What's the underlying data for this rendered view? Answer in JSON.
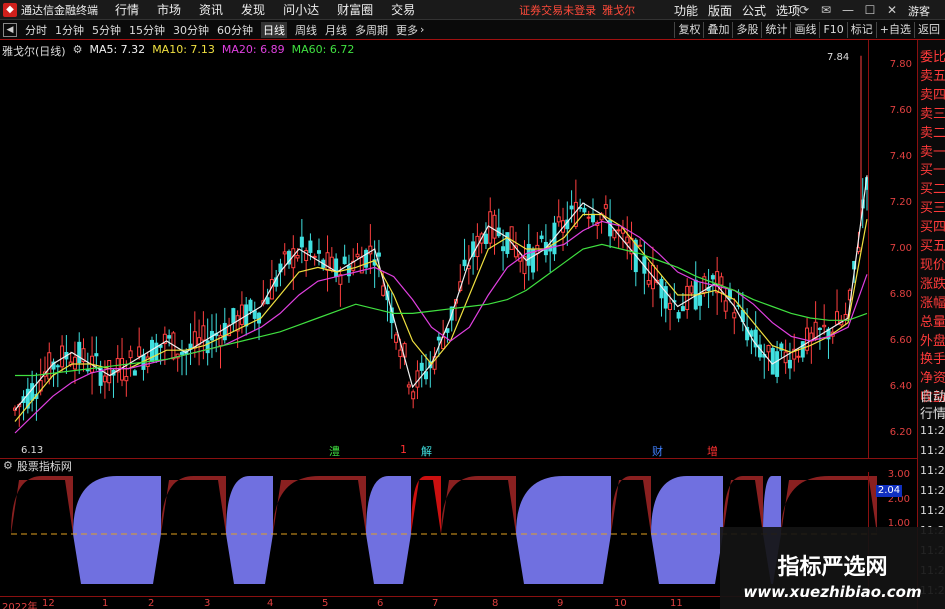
{
  "titlebar": {
    "app_title": "通达信金融终端",
    "menus": [
      "行情",
      "市场",
      "资讯",
      "发现",
      "问小达",
      "财富圈",
      "交易"
    ],
    "login_status": "证券交易未登录",
    "login_name": "雅戈尔",
    "right_menus": [
      "功能",
      "版面",
      "公式",
      "选项"
    ],
    "guest": "游客"
  },
  "toolbar": {
    "periods": [
      "分时",
      "1分钟",
      "5分钟",
      "15分钟",
      "30分钟",
      "60分钟",
      "日线",
      "周线",
      "月线",
      "多周期",
      "更多"
    ],
    "active_period": "日线",
    "right_tools": [
      "复权",
      "叠加",
      "多股",
      "统计",
      "画线",
      "F10",
      "标记",
      "+自选",
      "返回"
    ]
  },
  "chart": {
    "stock_label": "雅戈尔(日线)",
    "ma": [
      {
        "label": "MA5: 7.32",
        "color": "#f0f0f0"
      },
      {
        "label": "MA10: 7.13",
        "color": "#f0e040"
      },
      {
        "label": "MA20: 6.89",
        "color": "#e040e0"
      },
      {
        "label": "MA60: 6.72",
        "color": "#40e040"
      }
    ],
    "high_label": "7.84",
    "low_label": "6.13",
    "price_ticks": [
      "7.80",
      "7.60",
      "7.40",
      "7.20",
      "7.00",
      "6.80",
      "6.60",
      "6.40",
      "6.20"
    ],
    "events": [
      {
        "text": "澧",
        "color": "#40e040"
      },
      {
        "text": "1",
        "color": "#ff3030"
      },
      {
        "text": "解",
        "color": "#40e0e0"
      },
      {
        "text": "财",
        "color": "#4080ff"
      },
      {
        "text": "增",
        "color": "#ff3030"
      }
    ]
  },
  "side_panel": {
    "labels": [
      "委比",
      "卖五",
      "卖四",
      "卖三",
      "卖二",
      "卖一",
      "买一",
      "买二",
      "买三",
      "买四",
      "买五",
      "现价",
      "涨跌",
      "涨幅",
      "总量",
      "外盘",
      "换手",
      "净资",
      "收益"
    ],
    "extra": [
      "自动",
      "行情"
    ],
    "times": [
      "11:2",
      "11:2",
      "11:2",
      "11:2",
      "11:2",
      "11:2",
      "11:2",
      "11:2",
      "11:2"
    ]
  },
  "sub_chart": {
    "title": "股票指标网",
    "ticks": [
      "3.00",
      "2.00",
      "1.00"
    ],
    "current": "2.04"
  },
  "date_axis": {
    "labels": [
      "2022年",
      "12",
      "1",
      "2",
      "3",
      "4",
      "5",
      "6",
      "7",
      "8",
      "9",
      "10",
      "11"
    ]
  },
  "watermark": {
    "title": "指标严选网",
    "url": "www.xuezhibiao.com"
  },
  "chart_data": {
    "type": "candlestick",
    "price_range": [
      6.1,
      7.9
    ],
    "series": [
      {
        "name": "MA5",
        "values": [
          6.3,
          6.4,
          6.5,
          6.55,
          6.5,
          6.45,
          6.5,
          6.55,
          6.6,
          6.55,
          6.6,
          6.65,
          6.7,
          6.75,
          6.9,
          7.0,
          6.95,
          6.9,
          6.95,
          7.0,
          6.7,
          6.4,
          6.5,
          6.7,
          6.95,
          7.1,
          7.05,
          6.95,
          7.0,
          7.1,
          7.2,
          7.15,
          7.05,
          6.95,
          6.85,
          6.75,
          6.8,
          6.85,
          6.75,
          6.6,
          6.5,
          6.55,
          6.6,
          6.65,
          6.7,
          7.32
        ]
      },
      {
        "name": "MA10",
        "values": [
          6.25,
          6.35,
          6.45,
          6.5,
          6.5,
          6.48,
          6.48,
          6.52,
          6.56,
          6.56,
          6.58,
          6.62,
          6.66,
          6.7,
          6.8,
          6.9,
          6.92,
          6.9,
          6.92,
          6.95,
          6.8,
          6.6,
          6.5,
          6.6,
          6.8,
          7.0,
          7.05,
          7.0,
          7.0,
          7.05,
          7.15,
          7.15,
          7.1,
          7.0,
          6.9,
          6.8,
          6.8,
          6.82,
          6.78,
          6.68,
          6.58,
          6.55,
          6.58,
          6.62,
          6.68,
          7.13
        ]
      },
      {
        "name": "MA20",
        "values": [
          6.2,
          6.28,
          6.36,
          6.42,
          6.46,
          6.48,
          6.48,
          6.5,
          6.52,
          6.54,
          6.56,
          6.58,
          6.62,
          6.66,
          6.72,
          6.8,
          6.86,
          6.88,
          6.9,
          6.92,
          6.88,
          6.78,
          6.66,
          6.6,
          6.66,
          6.8,
          6.92,
          6.98,
          7.0,
          7.02,
          7.08,
          7.12,
          7.1,
          7.05,
          6.98,
          6.9,
          6.86,
          6.84,
          6.82,
          6.76,
          6.68,
          6.62,
          6.6,
          6.62,
          6.66,
          6.89
        ]
      },
      {
        "name": "MA60",
        "values": [
          6.45,
          6.45,
          6.46,
          6.47,
          6.48,
          6.49,
          6.5,
          6.51,
          6.52,
          6.54,
          6.56,
          6.58,
          6.6,
          6.62,
          6.64,
          6.67,
          6.7,
          6.73,
          6.76,
          6.74,
          6.72,
          6.72,
          6.73,
          6.74,
          6.75,
          6.76,
          6.78,
          6.82,
          6.88,
          6.94,
          7.0,
          7.02,
          7.0,
          6.98,
          6.95,
          6.92,
          6.88,
          6.85,
          6.82,
          6.78,
          6.75,
          6.72,
          6.7,
          6.69,
          6.69,
          6.72
        ]
      }
    ],
    "xlabel": "",
    "ylabel": ""
  }
}
